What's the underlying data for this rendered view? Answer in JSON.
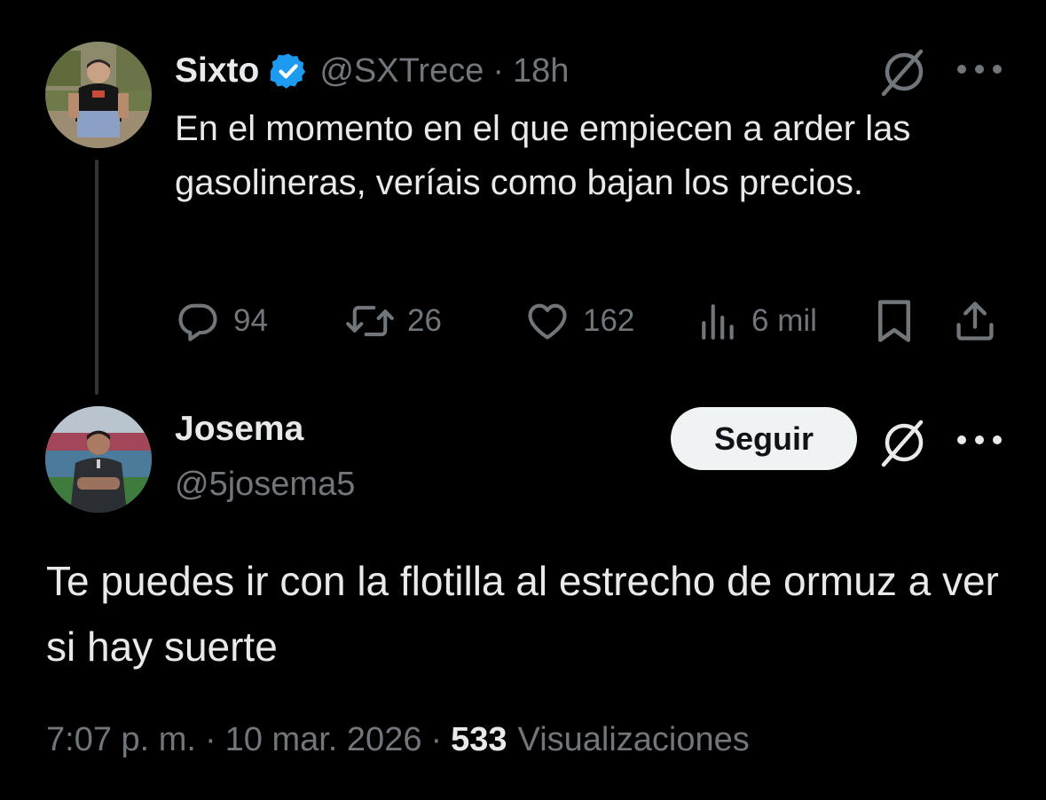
{
  "parent_tweet": {
    "author_name": "Sixto",
    "handle": "@SXTrece",
    "separator": "·",
    "time_ago": "18h",
    "text": "En el momento en el que empiecen a arder las gasolineras, veríais como bajan los precios.",
    "replies": "94",
    "reposts": "26",
    "likes": "162",
    "views": "6 mil"
  },
  "reply_tweet": {
    "author_name": "Josema",
    "handle": "@5josema5",
    "follow_label": "Seguir",
    "text": "Te puedes ir con la flotilla al estrecho de ormuz a ver si hay suerte",
    "time": "7:07 p. m.",
    "separator": "·",
    "date": "10 mar. 2026",
    "views_count": "533",
    "views_label": "Visualizaciones"
  },
  "icons": {
    "verified": "verified-badge-icon",
    "grok": "grok-icon",
    "more": "more-icon",
    "reply": "reply-icon",
    "repost": "repost-icon",
    "like": "like-icon",
    "views": "views-icon",
    "bookmark": "bookmark-icon",
    "share": "share-icon"
  },
  "colors": {
    "background": "#000000",
    "primary_text": "#e7e9ea",
    "secondary_text": "#71767b",
    "verified_blue": "#1d9bf0",
    "follow_button_bg": "#eff3f4"
  }
}
